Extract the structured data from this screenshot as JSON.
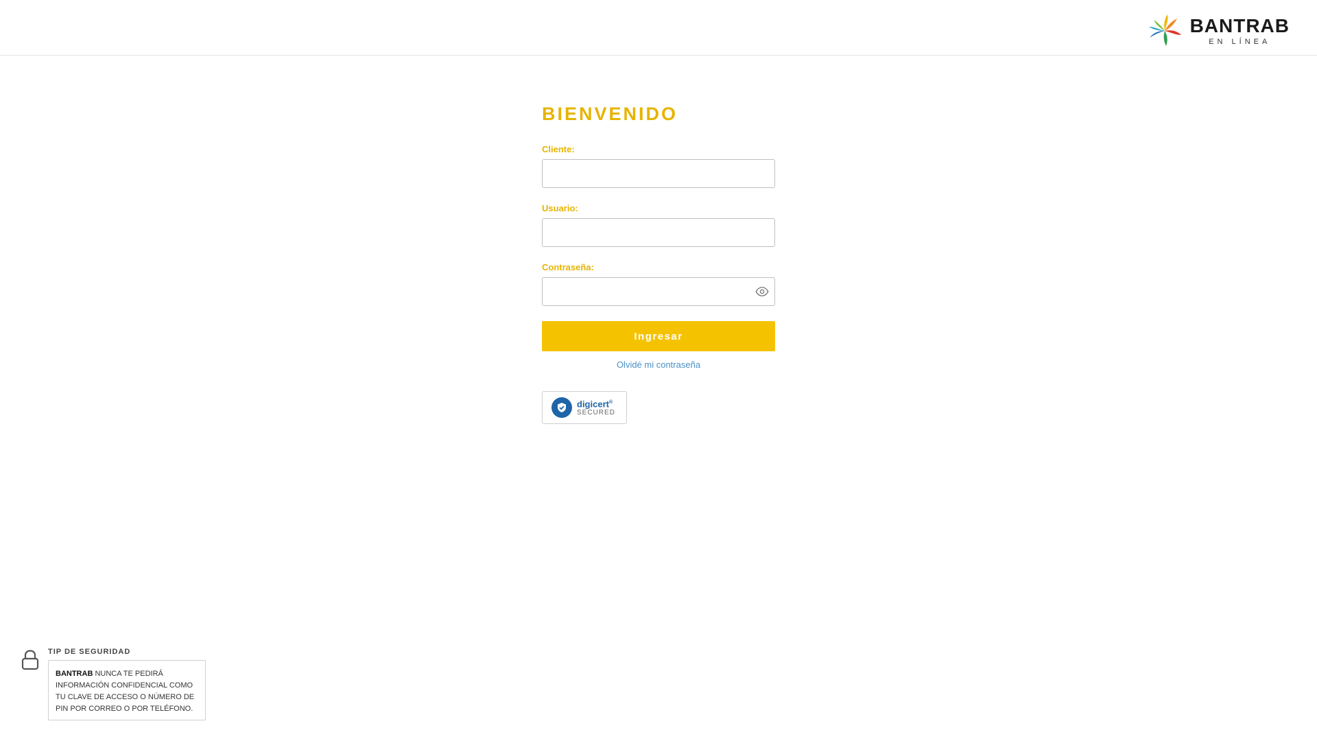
{
  "header": {
    "brand_name": "BANTRAB",
    "brand_sub": "EN LÍNEA",
    "logo_icon": "pinwheel-star-logo"
  },
  "login": {
    "title": "BIENVENIDO",
    "client_label": "Cliente:",
    "client_value": "",
    "user_label": "Usuario:",
    "user_value": "",
    "password_label": "Contraseña:",
    "password_value": "",
    "show_password_icon": "eye-icon",
    "submit_label": "Ingresar",
    "forgot_label": "Olvidé mi contraseña"
  },
  "seal": {
    "name": "digicert",
    "status": "SECURED",
    "icon": "shield-check-icon"
  },
  "tip": {
    "heading": "TIP DE SEGURIDAD",
    "brand": "BANTRAB",
    "message": " NUNCA TE PEDIRÁ INFORMACIÓN CONFIDENCIAL COMO TU CLAVE DE ACCESO O NÚMERO DE PIN POR CORREO O POR TELÉFONO.",
    "icon": "lock-icon"
  },
  "colors": {
    "accent": "#f5c200",
    "label": "#e6b400",
    "link": "#4a90c8",
    "seal_blue": "#1e64a8"
  }
}
